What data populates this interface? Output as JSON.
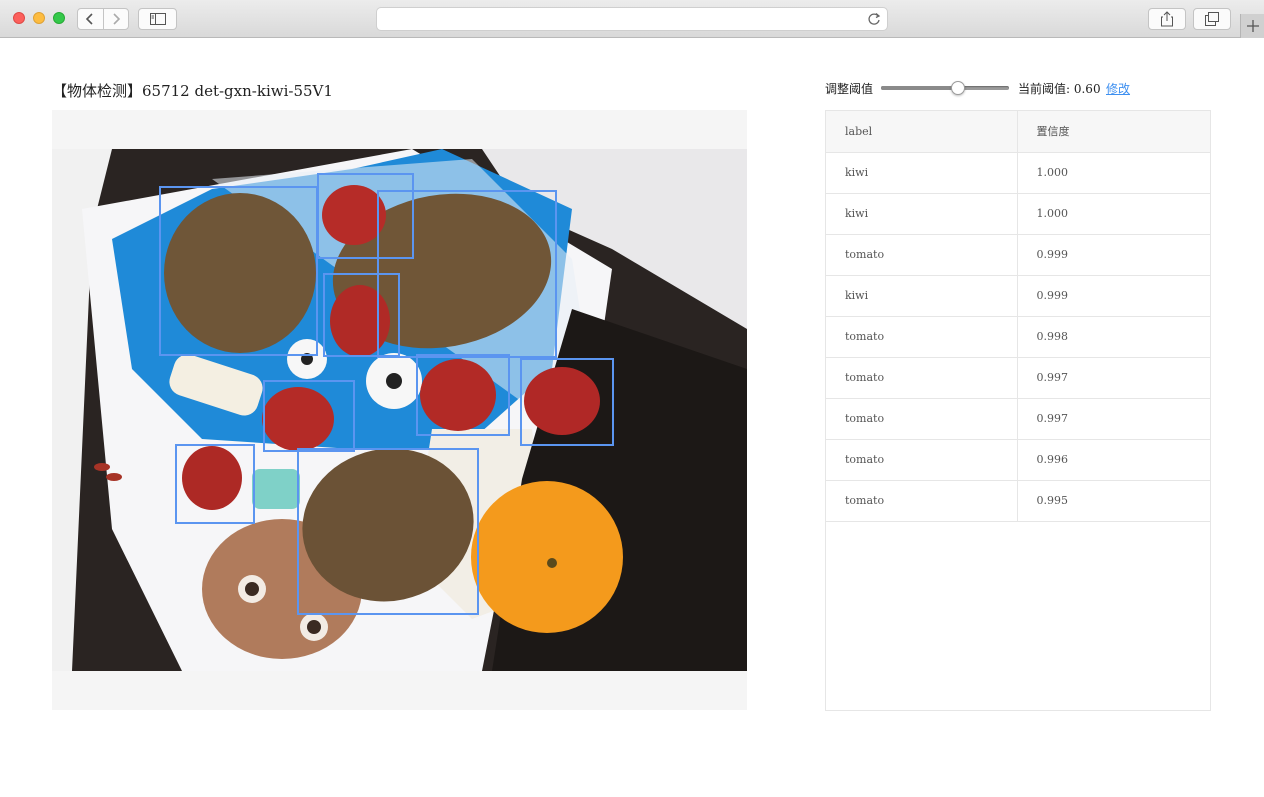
{
  "browser": {
    "nav_icons": [
      "chevron-left-icon",
      "chevron-right-icon",
      "sidebar-icon",
      "reload-icon",
      "share-icon",
      "tabs-icon",
      "plus-icon"
    ]
  },
  "page": {
    "title": "【物体检测】65712  det-gxn-kiwi-55V1"
  },
  "threshold": {
    "adjust_label": "调整阈值",
    "value": 0.6,
    "current_label": "当前阈值: 0.60",
    "edit_label": "修改"
  },
  "results": {
    "headers": [
      "label",
      "置信度"
    ],
    "rows": [
      {
        "label": "kiwi",
        "confidence": "1.000"
      },
      {
        "label": "kiwi",
        "confidence": "1.000"
      },
      {
        "label": "tomato",
        "confidence": "0.999"
      },
      {
        "label": "kiwi",
        "confidence": "0.999"
      },
      {
        "label": "tomato",
        "confidence": "0.998"
      },
      {
        "label": "tomato",
        "confidence": "0.997"
      },
      {
        "label": "tomato",
        "confidence": "0.997"
      },
      {
        "label": "tomato",
        "confidence": "0.996"
      },
      {
        "label": "tomato",
        "confidence": "0.995"
      }
    ]
  },
  "colors": {
    "box_stroke": "#5b95f0",
    "link": "#3d8ff0"
  }
}
